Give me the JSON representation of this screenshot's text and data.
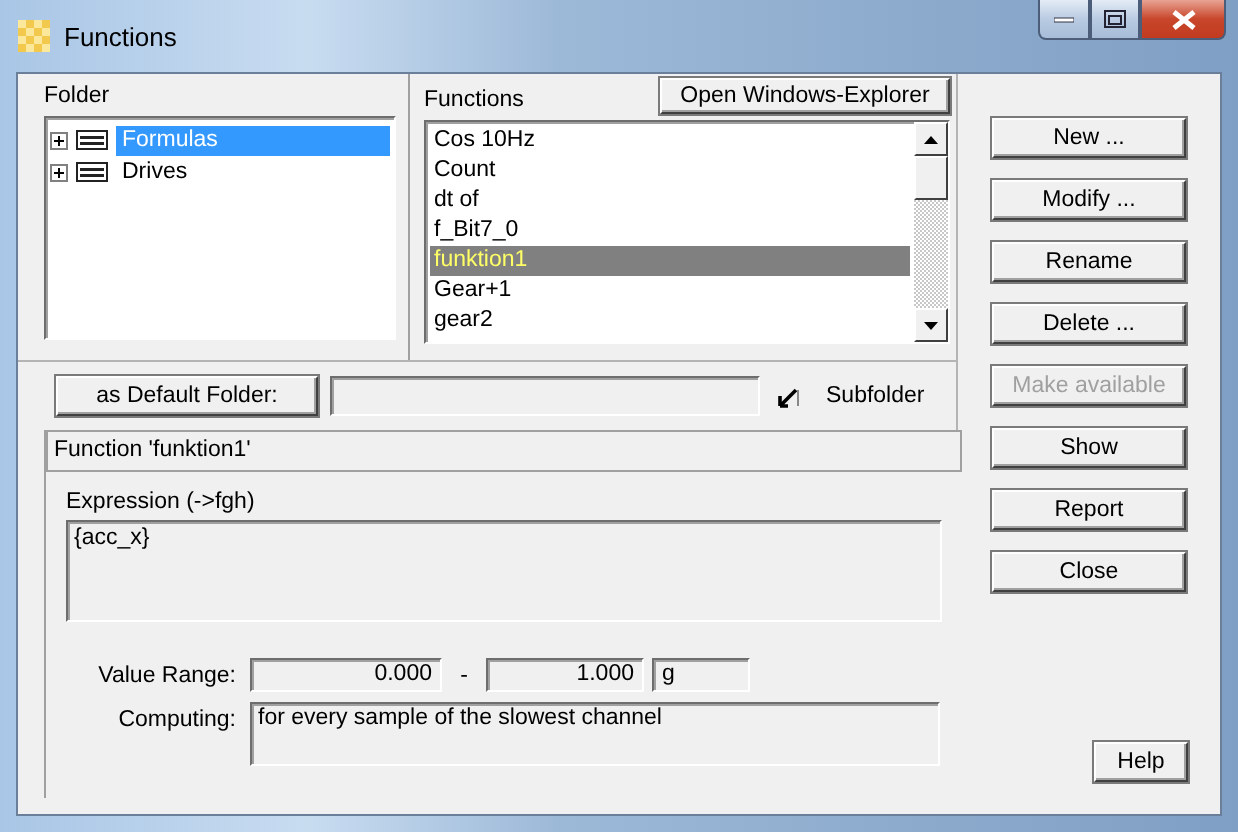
{
  "window": {
    "title": "Functions"
  },
  "folder": {
    "label": "Folder",
    "items": [
      {
        "label": "Formulas",
        "selected": true,
        "expanded": false
      },
      {
        "label": "Drives",
        "selected": false,
        "expanded": false
      }
    ]
  },
  "functions": {
    "label": "Functions",
    "explorer_button": "Open Windows-Explorer",
    "items": [
      {
        "label": "Cos 10Hz",
        "selected": false
      },
      {
        "label": "Count",
        "selected": false
      },
      {
        "label": "dt of",
        "selected": false
      },
      {
        "label": "f_Bit7_0",
        "selected": false
      },
      {
        "label": "funktion1",
        "selected": true
      },
      {
        "label": "Gear+1",
        "selected": false
      },
      {
        "label": "gear2",
        "selected": false
      }
    ]
  },
  "default_folder": {
    "button": "as Default Folder:",
    "subfolder": {
      "label": "Subfolder",
      "checked": true
    }
  },
  "function_panel": {
    "title": "Function 'funktion1'",
    "expression_label": "Expression (->fgh)",
    "expression": "{acc_x}",
    "value_range_label": "Value Range:",
    "range_min": "0.000",
    "range_separator": "-",
    "range_max": "1.000",
    "unit": "g",
    "computing_label": "Computing:",
    "computing": "for every sample of the slowest channel"
  },
  "buttons": [
    {
      "label": "New ...",
      "disabled": false
    },
    {
      "label": "Modify ...",
      "disabled": false
    },
    {
      "label": "Rename",
      "disabled": false
    },
    {
      "label": "Delete ...",
      "disabled": false
    },
    {
      "label": "Make available",
      "disabled": true
    },
    {
      "label": "Show",
      "disabled": false
    },
    {
      "label": "Report",
      "disabled": false
    },
    {
      "label": "Close",
      "disabled": false
    }
  ],
  "help_button": "Help"
}
